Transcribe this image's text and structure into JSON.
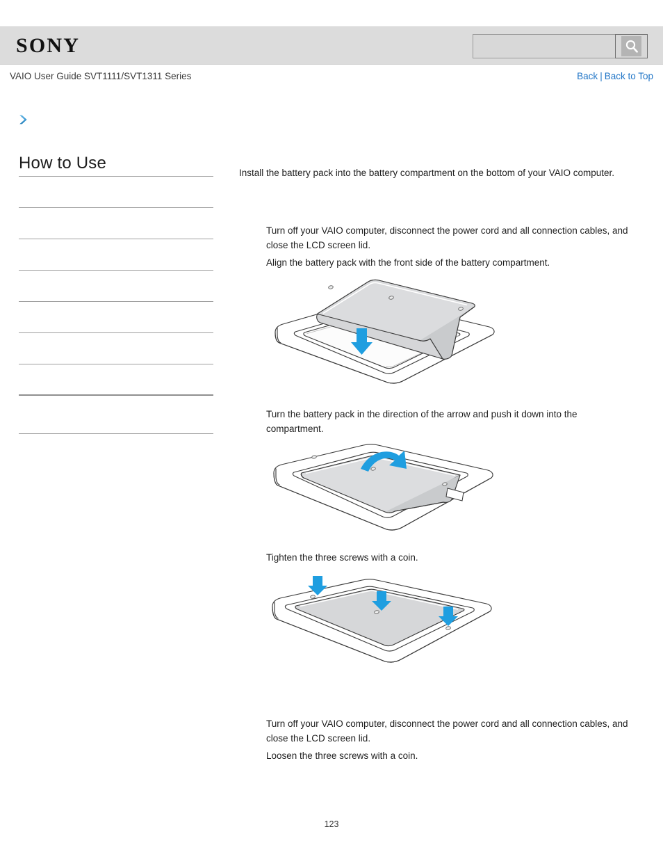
{
  "header": {
    "logo_text": "SONY",
    "search": {
      "value": "",
      "placeholder": "",
      "button_icon": "search-icon"
    }
  },
  "subheader": {
    "guide_title": "VAIO User Guide SVT1111/SVT1311 Series",
    "back_label": "Back",
    "separator": "|",
    "back_to_top_label": "Back to Top"
  },
  "breadcrumb_icon": "chevron-right-icon",
  "sidebar": {
    "title": "How to Use",
    "items": [
      {
        "label": ""
      },
      {
        "label": ""
      },
      {
        "label": ""
      },
      {
        "label": ""
      },
      {
        "label": ""
      },
      {
        "label": ""
      },
      {
        "label": ""
      },
      {
        "label": ""
      },
      {
        "label": ""
      }
    ]
  },
  "main": {
    "intro": "Install the battery pack into the battery compartment on the bottom of your VAIO computer.",
    "steps": [
      {
        "text": "Turn off your VAIO computer, disconnect the power cord and all connection cables, and close the LCD screen lid."
      },
      {
        "text": "Align the battery pack with the front side of the battery compartment."
      },
      {
        "text": "Turn the battery pack in the direction of the arrow and push it down into the compartment."
      },
      {
        "text": "Tighten the three screws with a coin."
      },
      {
        "text": "Turn off your VAIO computer, disconnect the power cord and all connection cables, and close the LCD screen lid."
      },
      {
        "text": "Loosen the three screws with a coin."
      }
    ],
    "figures": [
      {
        "name": "battery-align-illustration",
        "caption": ""
      },
      {
        "name": "battery-rotate-illustration",
        "caption": ""
      },
      {
        "name": "battery-screws-illustration",
        "caption": ""
      }
    ]
  },
  "footer": {
    "page_number": "123"
  },
  "colors": {
    "link": "#2176c7",
    "header_bg": "#dcdcdc",
    "arrow_blue": "#1f9ee0",
    "line_gray": "#9e9e9e"
  }
}
